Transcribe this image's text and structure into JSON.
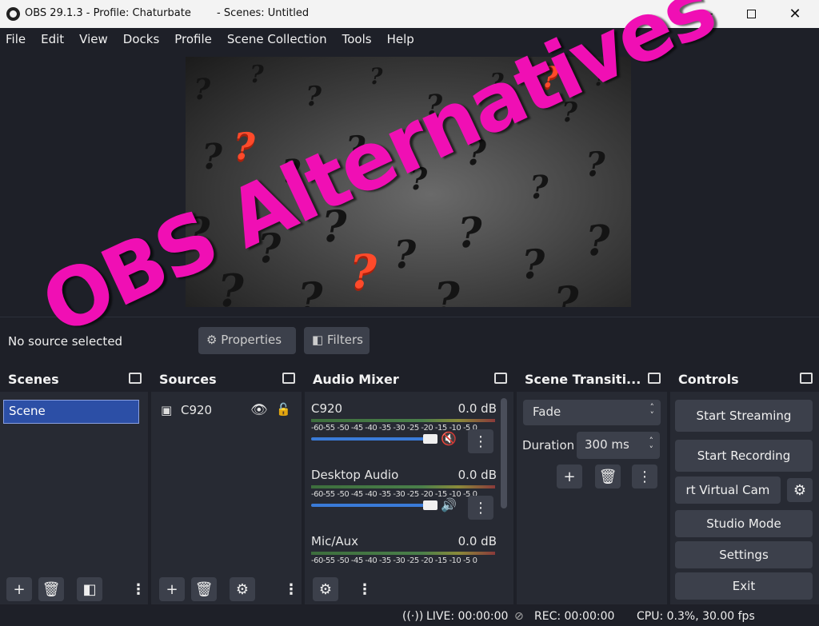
{
  "window": {
    "title": "OBS 29.1.3 - Profile: Chaturbate",
    "scenes_title": "- Scenes: Untitled"
  },
  "menu": [
    "File",
    "Edit",
    "View",
    "Docks",
    "Profile",
    "Scene Collection",
    "Tools",
    "Help"
  ],
  "overlay_text": "OBS Alternatives",
  "source_bar": {
    "no_source": "No source selected",
    "properties": "Properties",
    "filters": "Filters"
  },
  "scenes": {
    "title": "Scenes",
    "items": [
      "Scene"
    ]
  },
  "sources": {
    "title": "Sources",
    "items": [
      "C920"
    ]
  },
  "mixer": {
    "title": "Audio Mixer",
    "ticks": "-60-55 -50 -45 -40 -35 -30 -25 -20 -15 -10 -5  0",
    "channels": [
      {
        "name": "C920",
        "db": "0.0 dB",
        "muted": true,
        "volume_pct": 100
      },
      {
        "name": "Desktop Audio",
        "db": "0.0 dB",
        "muted": false,
        "volume_pct": 100
      },
      {
        "name": "Mic/Aux",
        "db": "0.0 dB",
        "muted": false,
        "volume_pct": 100
      }
    ]
  },
  "transitions": {
    "title": "Scene Transiti...",
    "selected": "Fade",
    "duration_label": "Duration",
    "duration_value": "300 ms"
  },
  "controls": {
    "title": "Controls",
    "start_streaming": "Start Streaming",
    "start_recording": "Start Recording",
    "virtual_cam": "rt Virtual Cam",
    "studio_mode": "Studio Mode",
    "settings": "Settings",
    "exit": "Exit"
  },
  "status": {
    "live": "LIVE: 00:00:00",
    "rec": "REC: 00:00:00",
    "cpu": "CPU: 0.3%, 30.00 fps"
  },
  "colors": {
    "accent": "#2c4fa6",
    "overlay": "#f00fb4",
    "mute_red": "#d02828"
  }
}
